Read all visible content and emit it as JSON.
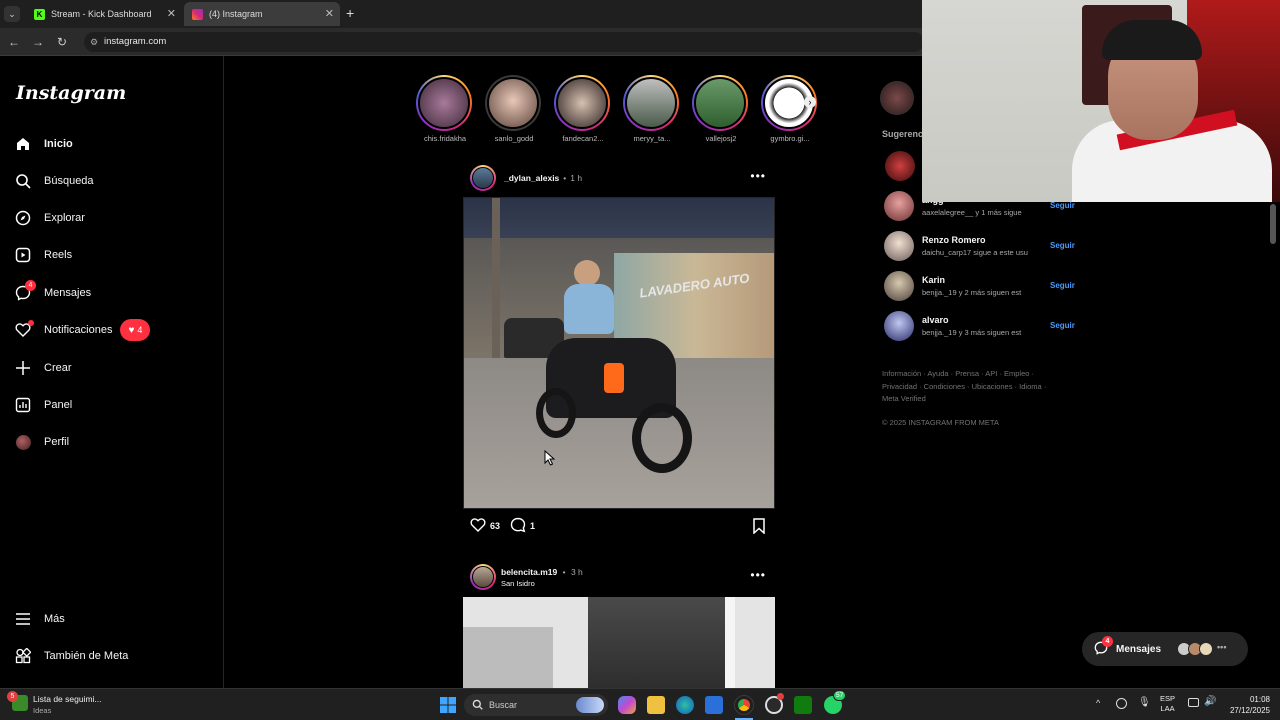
{
  "browser": {
    "tabs": [
      {
        "label": "Stream - Kick Dashboard",
        "favicon": "kick-icon"
      },
      {
        "label": "(4) Instagram",
        "favicon": "instagram-icon"
      }
    ],
    "url": "instagram.com"
  },
  "sidebar": {
    "logo": "Instagram",
    "items": [
      {
        "label": "Inicio",
        "icon": "home-icon"
      },
      {
        "label": "Búsqueda",
        "icon": "search-icon"
      },
      {
        "label": "Explorar",
        "icon": "compass-icon"
      },
      {
        "label": "Reels",
        "icon": "reels-icon"
      },
      {
        "label": "Mensajes",
        "icon": "messenger-icon",
        "badge": "4"
      },
      {
        "label": "Notificaciones",
        "icon": "heart-icon",
        "pill": "4"
      },
      {
        "label": "Crear",
        "icon": "plus-icon"
      },
      {
        "label": "Panel",
        "icon": "chart-icon"
      },
      {
        "label": "Perfil",
        "icon": "profile-icon"
      }
    ],
    "bottom": [
      {
        "label": "Más",
        "icon": "menu-icon"
      },
      {
        "label": "También de Meta",
        "icon": "meta-icon"
      }
    ]
  },
  "stories": [
    {
      "name": "chis.fridakha"
    },
    {
      "name": "sanlo_godd"
    },
    {
      "name": "fandecan2..."
    },
    {
      "name": "meryy_ta..."
    },
    {
      "name": "vallejosj2"
    },
    {
      "name": "gymbro.gi..."
    }
  ],
  "post1": {
    "user": "_dylan_alexis",
    "time": "1 h",
    "likes": "63",
    "comments": "1",
    "image_text": "LAVADERO AUTO"
  },
  "post2": {
    "user": "belencita.m19",
    "time": "3 h",
    "location": "San Isidro"
  },
  "right": {
    "suggest_title": "Sugerencias",
    "suggestions": [
      {
        "name": "angg",
        "sub": "aaxelalegree__ y 1 más sigue",
        "follow": "Seguir"
      },
      {
        "name": "Renzo Romero",
        "sub": "daichu_carp17 sigue a este usu",
        "follow": "Seguir"
      },
      {
        "name": "Karin",
        "sub": "benjja._19 y 2 más siguen est",
        "follow": "Seguir"
      },
      {
        "name": "alvaro",
        "sub": "benjja._19 y 3 más siguen est",
        "follow": "Seguir"
      }
    ],
    "footer_links": "Información · Ayuda · Prensa · API · Empleo · Privacidad · Condiciones · Ubicaciones · Idioma · Meta Verified",
    "copyright": "© 2025 INSTAGRAM FROM META"
  },
  "messages_widget": {
    "label": "Mensajes",
    "badge": "4"
  },
  "taskbar": {
    "widget_title": "Lista de seguimi...",
    "widget_sub": "Ideas",
    "widget_badge": "5",
    "search": "Buscar",
    "whatsapp_badge": "57",
    "lang": "ESP",
    "lang2": "LAA",
    "time": "01:08",
    "date": "27/12/2025"
  }
}
